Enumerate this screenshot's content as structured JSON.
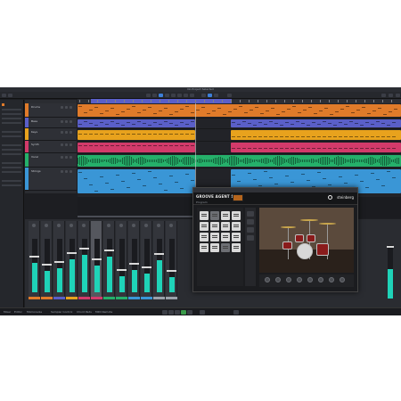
{
  "window": {
    "title": "No Project Selected"
  },
  "colors": {
    "background": "#1d1e22",
    "accent": "#3d7fd9",
    "meter": "#1fd3b8",
    "ruler_range": "#5a5fc8"
  },
  "tracks": [
    {
      "name": "Drums",
      "color": "#e07b2a"
    },
    {
      "name": "Bass",
      "color": "#5a5fc8"
    },
    {
      "name": "Keys",
      "color": "#e8a21d"
    },
    {
      "name": "Synth",
      "color": "#d23a6a"
    },
    {
      "name": "Vocal",
      "color": "#25b06a"
    },
    {
      "name": "Strings",
      "color": "#3a96d6"
    }
  ],
  "plugin": {
    "name": "GROOVE AGENT SE 5",
    "preset": "Program",
    "brand": "steinberg",
    "pad_count": 16
  },
  "mixer": {
    "channel_levels": [
      0.55,
      0.4,
      0.45,
      0.62,
      0.7,
      0.5,
      0.66,
      0.3,
      0.42,
      0.35,
      0.6,
      0.28
    ],
    "right_channel_level": 0.55
  },
  "status": {
    "tabs": [
      "Mixer",
      "Editor",
      "MixConsole",
      "Sampler Control",
      "Chord Pads",
      "MIDI Remote"
    ]
  }
}
